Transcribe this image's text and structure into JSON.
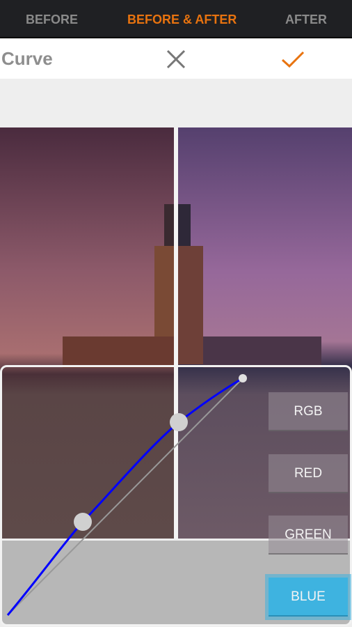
{
  "view_tabs": [
    {
      "label": "BEFORE",
      "active": false
    },
    {
      "label": "BEFORE & AFTER",
      "active": true
    },
    {
      "label": "AFTER",
      "active": false
    }
  ],
  "toolbar": {
    "title": "Curve",
    "cancel_icon": "close-icon",
    "confirm_icon": "check-icon"
  },
  "channels": [
    {
      "label": "RGB",
      "active": false
    },
    {
      "label": "RED",
      "active": false
    },
    {
      "label": "GREEN",
      "active": false
    },
    {
      "label": "BLUE",
      "active": true
    }
  ],
  "colors": {
    "accent": "#e8730f",
    "active_channel": "#3eb3e0",
    "curve": "#0000ff"
  }
}
